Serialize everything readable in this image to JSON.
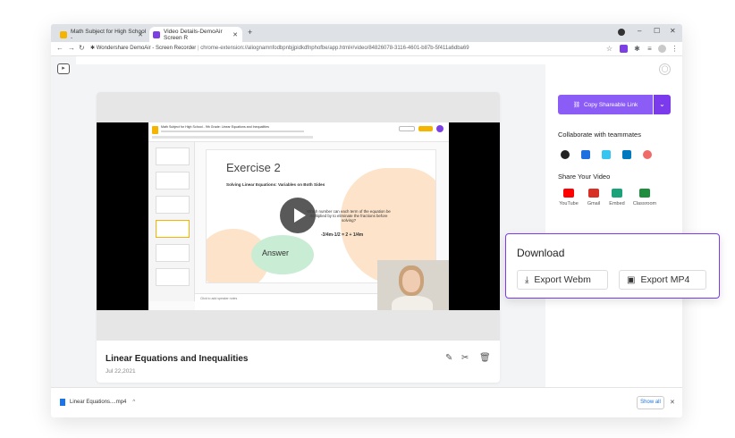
{
  "browser": {
    "tabs": [
      {
        "title": "Math Subject for High School - ",
        "favicon_color": "#f4b400"
      },
      {
        "title": "Video Details-DemoAir Screen R",
        "favicon_color": "#7b3fe4"
      }
    ],
    "new_tab": "+",
    "url_prefix": "Wondershare DemoAir - Screen Recorder",
    "url": "chrome-extension://aliognamnfodbpnbjjpidkdfnphofbe/app.html#/video/84826078-3116-4601-b87b-5f411a6dba69",
    "controls": {
      "minimize": "–",
      "maximize": "☐",
      "close": "✕"
    }
  },
  "video": {
    "title": "Linear Equations and Inequalities",
    "date": "Jul 22,2021",
    "slide": {
      "doc_title": "Math Subject for High School - 9th Grade: Linear Equations and Inequalities",
      "heading": "Exercise 2",
      "subheading": "Solving Linear Equations: Variables on Both Sides",
      "question": "Which number can each term of the equation be multiplied by to eliminate the fractions before solving?",
      "equation": "-3/4m-1/2 = 2 + 1/4m",
      "answer": "Answer",
      "notes": "Click to add speaker notes"
    }
  },
  "share_panel": {
    "copy_link": "Copy Shareable Link",
    "collaborate_title": "Collaborate with teammates",
    "collab_apps": [
      {
        "name": "github-icon",
        "color": "#222222"
      },
      {
        "name": "jira-icon",
        "color": "#1e6fe0"
      },
      {
        "name": "slack-icon",
        "color": "#36c5f0"
      },
      {
        "name": "trello-icon",
        "color": "#0079bf"
      },
      {
        "name": "asana-icon",
        "color": "#f06a6a"
      }
    ],
    "share_title": "Share Your Video",
    "share_items": [
      {
        "label": "YouTube",
        "color": "#ff0000"
      },
      {
        "label": "Gmail",
        "color": "#d93025"
      },
      {
        "label": "Embed",
        "color": "#1aa37a"
      },
      {
        "label": "Classroom",
        "color": "#1e8e3e"
      }
    ]
  },
  "download": {
    "title": "Download",
    "export_webm": "Export Webm",
    "export_mp4": "Export MP4"
  },
  "download_bar": {
    "file": "Linear Equations....mp4",
    "chevron": "^",
    "show_all": "Show all",
    "close": "✕"
  },
  "colors": {
    "accent": "#8b5cf6",
    "accent_dark": "#7c3aed"
  }
}
